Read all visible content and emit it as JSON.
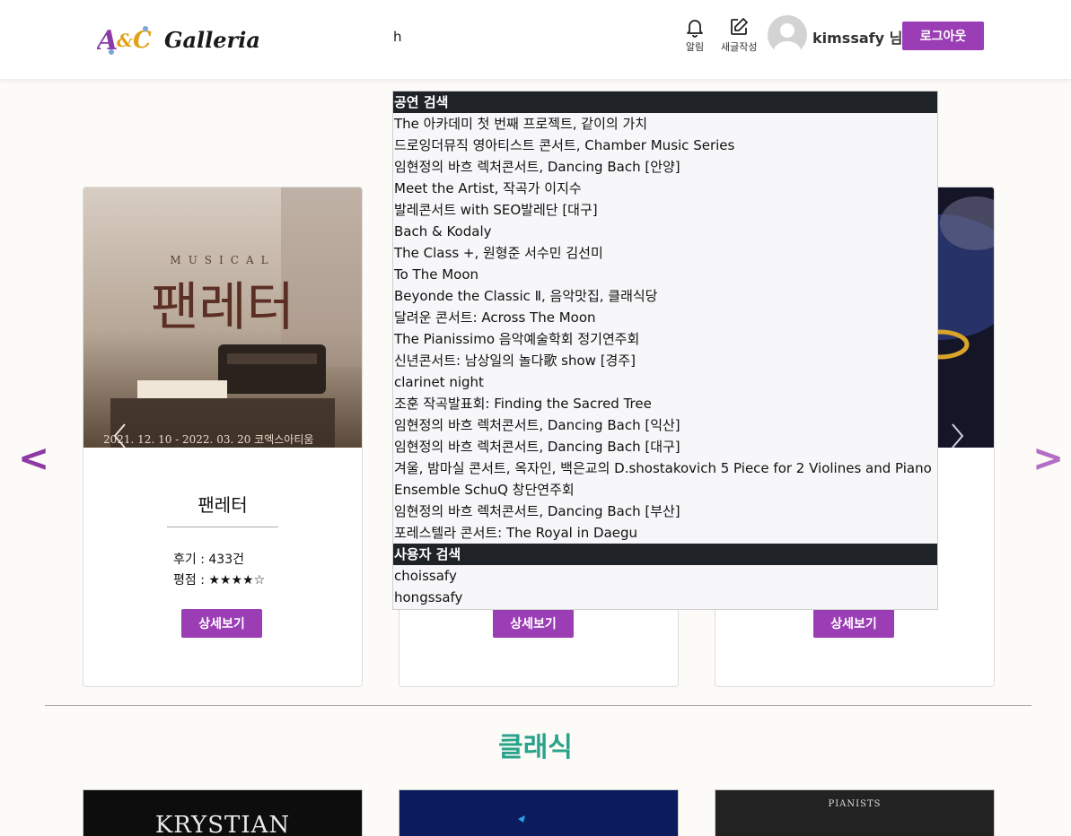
{
  "header": {
    "logo_text": "A&C Galleria",
    "search_value": "h",
    "notifications_label": "알림",
    "new_post_label": "새글작성",
    "username": "kimssafy 님",
    "logout_label": "로그아웃"
  },
  "carousel": {
    "prev_label": "<",
    "next_label": ">",
    "cards": [
      {
        "poster_main": "팬레터",
        "poster_sub": "MUSICAL",
        "poster_date": "2021. 12. 10 - 2022. 03. 20  코엑스아티움",
        "title": "팬레터",
        "reviews": "후기 : 433건",
        "rating": "평점 : ★★★★☆",
        "detail_label": "상세보기"
      },
      {
        "detail_label": "상세보기"
      },
      {
        "detail_label": "상세보기"
      }
    ]
  },
  "section": {
    "title": "클래식",
    "thumb_texts": [
      "KRYSTIAN",
      "PIANISTS"
    ]
  },
  "search_dropdown": {
    "performance_header": "공연 검색",
    "performances": [
      "The 아카데미 첫 번째 프로젝트, 같이의 가치",
      "드로잉더뮤직 영아티스트 콘서트, Chamber Music Series",
      "임현정의 바흐 렉처콘서트, Dancing Bach [안양]",
      "Meet the Artist, 작곡가 이지수",
      "발레콘서트 with SEO발레단 [대구]",
      "Bach & Kodaly",
      "The Class +, 원형준 서수민 김선미",
      "To The Moon",
      "Beyonde the Classic Ⅱ, 음악맛집, 클래식당",
      "달려운 콘서트: Across The Moon",
      "The Pianissimo 음악예술학회 정기연주회",
      "신년콘서트: 남상일의 놀다歌 show [경주]",
      "clarinet night",
      "조훈 작곡발표회: Finding the Sacred Tree",
      "임현정의 바흐 렉처콘서트, Dancing Bach [익산]",
      "임현정의 바흐 렉처콘서트, Dancing Bach [대구]",
      "겨울, 밤마실 콘서트, 옥자인, 백은교의 D.shostakovich 5 Piece for 2 Violines and Piano",
      "Ensemble SchuQ 창단연주회",
      "임현정의 바흐 렉처콘서트, Dancing Bach [부산]",
      "포레스텔라 콘서트: The Royal in Daegu"
    ],
    "user_header": "사용자 검색",
    "users": [
      "choissafy",
      "hongssafy"
    ]
  },
  "colors": {
    "accent_purple": "#9b3db4",
    "section_green": "#2aa38a",
    "dropdown_header_bg": "#1f2227"
  }
}
